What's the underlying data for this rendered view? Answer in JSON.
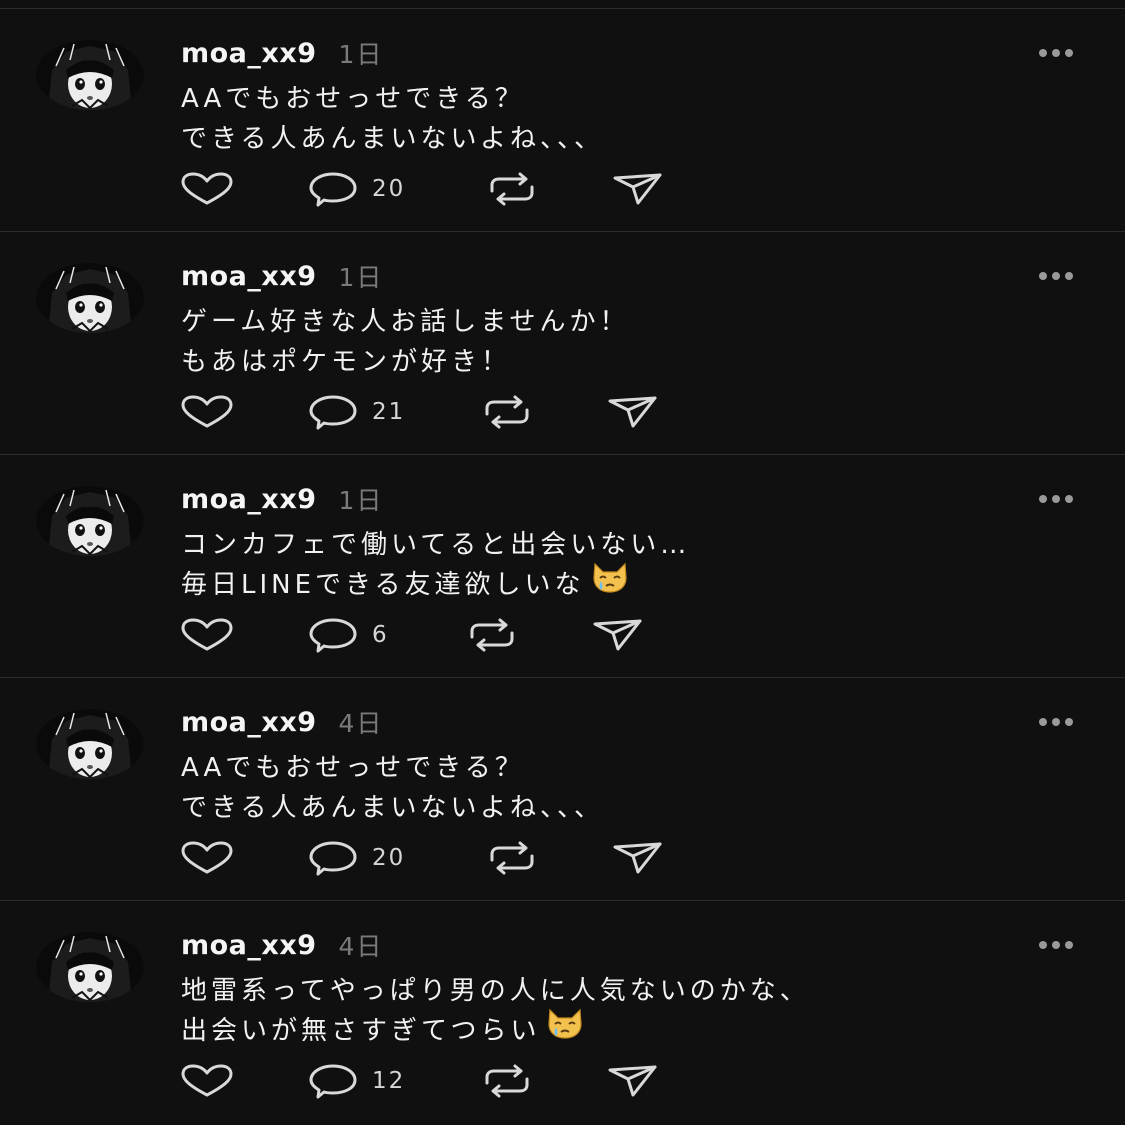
{
  "colors": {
    "background": "#101010",
    "divider": "#2c2c2c",
    "text": "#f1f1f1",
    "muted": "#7a7a7a",
    "icon": "#d9d9d9"
  },
  "posts": [
    {
      "username": "moa_xx9",
      "time": "1日",
      "lines": [
        "AAでもおせっせできる？",
        "できる人あんまいないよね、、、"
      ],
      "emoji": null,
      "reply_count": "20"
    },
    {
      "username": "moa_xx9",
      "time": "1日",
      "lines": [
        "ゲーム好きな人お話しませんか！",
        "もあはポケモンが好き！"
      ],
      "emoji": null,
      "reply_count": "21"
    },
    {
      "username": "moa_xx9",
      "time": "1日",
      "lines": [
        "コンカフェで働いてると出会いない…",
        "毎日LINEできる友達欲しいな"
      ],
      "emoji": "crying-cat-icon",
      "reply_count": "6"
    },
    {
      "username": "moa_xx9",
      "time": "4日",
      "lines": [
        "AAでもおせっせできる？",
        "できる人あんまいないよね、、、"
      ],
      "emoji": null,
      "reply_count": "20"
    },
    {
      "username": "moa_xx9",
      "time": "4日",
      "lines": [
        "地雷系ってやっぱり男の人に人気ないのかな、",
        "出会いが無さすぎてつらい"
      ],
      "emoji": "crying-cat-icon",
      "reply_count": "12"
    }
  ]
}
